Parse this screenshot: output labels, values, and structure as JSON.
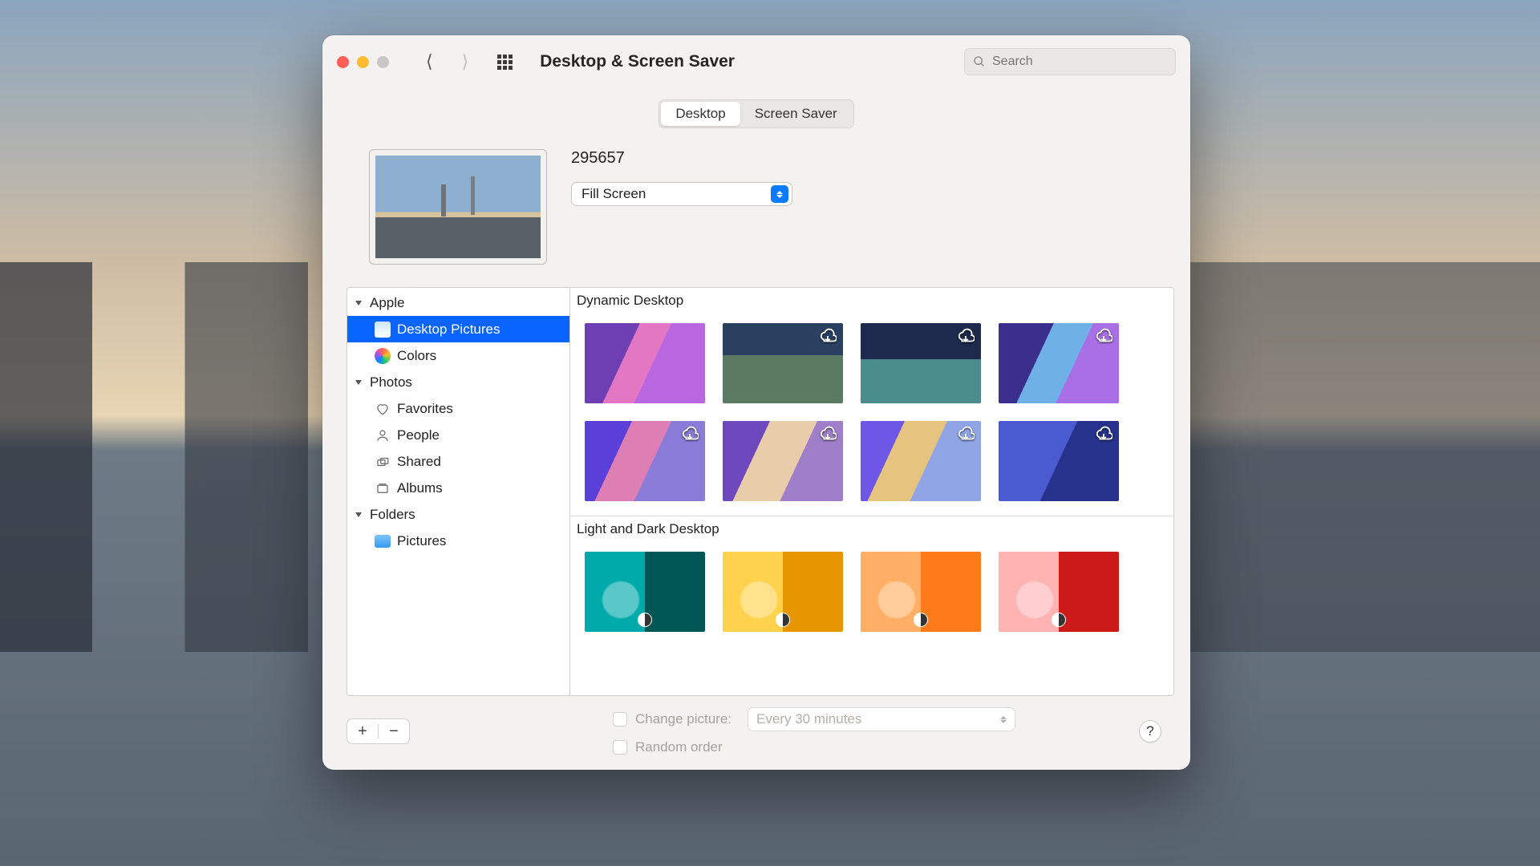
{
  "window": {
    "title": "Desktop & Screen Saver",
    "search_placeholder": "Search"
  },
  "tabs": {
    "desktop": "Desktop",
    "screensaver": "Screen Saver",
    "active": "desktop"
  },
  "current": {
    "name": "295657",
    "fit_mode": "Fill Screen"
  },
  "sidebar": {
    "apple": {
      "label": "Apple",
      "desktop_pictures": "Desktop Pictures",
      "colors": "Colors"
    },
    "photos": {
      "label": "Photos",
      "favorites": "Favorites",
      "people": "People",
      "shared": "Shared",
      "albums": "Albums"
    },
    "folders": {
      "label": "Folders",
      "pictures": "Pictures"
    }
  },
  "gallery": {
    "dynamic_title": "Dynamic Desktop",
    "lightdark_title": "Light and Dark Desktop",
    "dynamic": [
      {
        "download": false
      },
      {
        "download": true
      },
      {
        "download": true
      },
      {
        "download": true
      },
      {
        "download": true
      },
      {
        "download": true
      },
      {
        "download": true
      },
      {
        "download": true
      }
    ],
    "lightdark_count": 4
  },
  "footer": {
    "change_picture_label": "Change picture:",
    "interval": "Every 30 minutes",
    "random_label": "Random order",
    "help_glyph": "?"
  }
}
